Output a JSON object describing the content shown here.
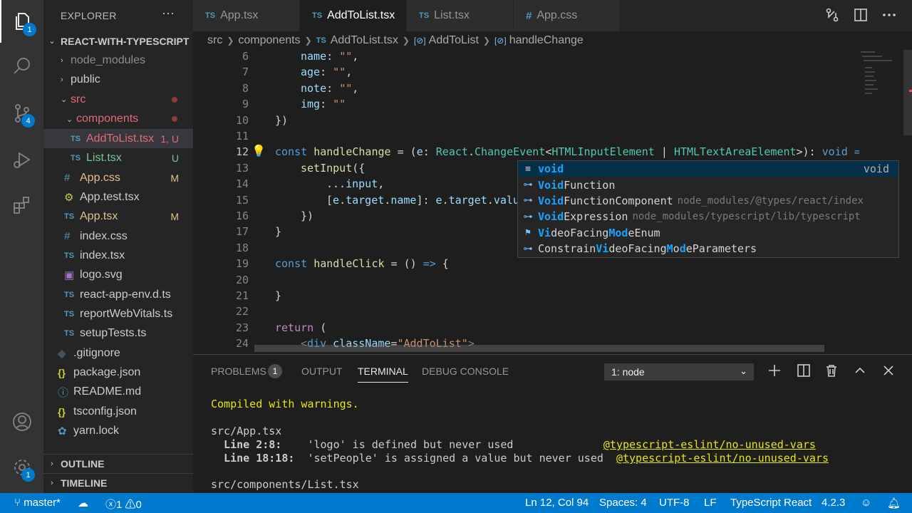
{
  "activity": {
    "explorer_badge": "1",
    "extensions_badge": "4",
    "settings_badge": "1"
  },
  "sidebar": {
    "title": "EXPLORER",
    "more": "···",
    "project": "REACT-WITH-TYPESCRIPT",
    "items": [
      {
        "label": "node_modules",
        "kind": "folder",
        "status": ""
      },
      {
        "label": "public",
        "kind": "folder",
        "status": ""
      },
      {
        "label": "src",
        "kind": "folder-open",
        "status": ""
      },
      {
        "label": "components",
        "kind": "folder-open",
        "status": ""
      },
      {
        "label": "AddToList.tsx",
        "kind": "ts",
        "status": "1, U"
      },
      {
        "label": "List.tsx",
        "kind": "ts",
        "status": "U"
      },
      {
        "label": "App.css",
        "kind": "css",
        "status": "M"
      },
      {
        "label": "App.test.tsx",
        "kind": "test",
        "status": ""
      },
      {
        "label": "App.tsx",
        "kind": "ts",
        "status": "M"
      },
      {
        "label": "index.css",
        "kind": "css",
        "status": ""
      },
      {
        "label": "index.tsx",
        "kind": "ts",
        "status": ""
      },
      {
        "label": "logo.svg",
        "kind": "svg",
        "status": ""
      },
      {
        "label": "react-app-env.d.ts",
        "kind": "ts",
        "status": ""
      },
      {
        "label": "reportWebVitals.ts",
        "kind": "ts",
        "status": ""
      },
      {
        "label": "setupTests.ts",
        "kind": "ts",
        "status": ""
      },
      {
        "label": ".gitignore",
        "kind": "git",
        "status": ""
      },
      {
        "label": "package.json",
        "kind": "json",
        "status": ""
      },
      {
        "label": "README.md",
        "kind": "info",
        "status": ""
      },
      {
        "label": "tsconfig.json",
        "kind": "json",
        "status": ""
      },
      {
        "label": "yarn.lock",
        "kind": "yarn",
        "status": ""
      }
    ],
    "outline": "OUTLINE",
    "timeline": "TIMELINE"
  },
  "tabs": [
    {
      "icon": "TS",
      "label": "App.tsx"
    },
    {
      "icon": "TS",
      "label": "AddToList.tsx"
    },
    {
      "icon": "TS",
      "label": "List.tsx"
    },
    {
      "icon": "#",
      "label": "App.css"
    }
  ],
  "breadcrumb": {
    "src": "src",
    "components": "components",
    "file": "AddToList.tsx",
    "component": "AddToList",
    "fn": "handleChange",
    "ts": "TS",
    "sym": "[⊘]"
  },
  "editor": {
    "line_numbers": [
      "6",
      "7",
      "8",
      "9",
      "10",
      "11",
      "12",
      "13",
      "14",
      "15",
      "16",
      "17",
      "18",
      "19",
      "20",
      "21",
      "22",
      "23",
      "24"
    ],
    "lines": {
      "l6a": "name",
      "l6b": ": ",
      "l6c": "\"\"",
      "l6d": ",",
      "l7a": "age",
      "l7b": ": ",
      "l7c": "\"\"",
      "l7d": ",",
      "l8a": "note",
      "l8b": ": ",
      "l8c": "\"\"",
      "l8d": ",",
      "l9a": "img",
      "l9b": ": ",
      "l9c": "\"\"",
      "l10": "})",
      "l12a": "const ",
      "l12b": "handleChange",
      "l12c": " = (",
      "l12d": "e",
      "l12e": ": ",
      "l12f": "React",
      "l12g": ".",
      "l12h": "ChangeEvent",
      "l12i": "<",
      "l12j": "HTMLInputElement",
      "l12k": " | ",
      "l12l": "HTMLTextAreaElement",
      "l12m": ">): ",
      "l12n": "void",
      "l12o": " =>",
      "l13a": "setInput",
      "l13b": "({",
      "l14a": "...",
      "l14b": "input",
      "l14c": ",",
      "l15a": "[",
      "l15b": "e",
      "l15c": ".",
      "l15d": "target",
      "l15e": ".",
      "l15f": "name",
      "l15g": "]: ",
      "l15h": "e",
      "l15i": ".",
      "l15j": "target",
      "l15k": ".",
      "l15l": "value",
      "l16": "})",
      "l17": "}",
      "l19a": "const ",
      "l19b": "handleClick",
      "l19c": " = () ",
      "l19d": "=>",
      "l19e": " {",
      "l21": "}",
      "l23a": "return",
      "l23b": " (",
      "l24a": "<",
      "l24b": "div",
      "l24c": " ",
      "l24d": "className",
      "l24e": "=",
      "l24f": "\"AddToList\"",
      "l24g": ">"
    }
  },
  "suggest": {
    "items": [
      {
        "icon": "≡",
        "match": "void",
        "rest": "",
        "detail": "",
        "right": "void"
      },
      {
        "icon": "⊶",
        "match": "Void",
        "rest": "Function",
        "detail": "",
        "right": ""
      },
      {
        "icon": "⊶",
        "match": "Void",
        "rest": "FunctionComponent",
        "detail": "node_modules/@types/react/index",
        "right": ""
      },
      {
        "icon": "⊶",
        "match": "Void",
        "rest": "Expression",
        "detail": "node_modules/typescript/lib/typescript",
        "right": ""
      },
      {
        "icon": "⚑",
        "p1": "V",
        "p2": "i",
        "p3": "deoFacing",
        "p4": "Mod",
        "p5": "eEnum"
      },
      {
        "icon": "⊶",
        "p1": "Constrain",
        "p2": "Vi",
        "p3": "deoFacing",
        "p4": "M",
        "p5": "o",
        "p6": "d",
        "p7": "eParameters"
      }
    ]
  },
  "panel": {
    "tabs": [
      "PROBLEMS",
      "OUTPUT",
      "TERMINAL",
      "DEBUG CONSOLE"
    ],
    "problems_count": "1",
    "terminal_select": "1: node",
    "terminal": {
      "compiled": "Compiled with warnings.",
      "file1": "src/App.tsx",
      "w1_loc": "  Line 2:8:",
      "w1_msg": "    'logo' is defined but never used              ",
      "w1_rule": "@typescript-eslint/no-unused-vars",
      "w2_loc": "  Line 18:18:",
      "w2_msg": "  'setPeople' is assigned a value but never used  ",
      "w2_rule": "@typescript-eslint/no-unused-vars",
      "file2": "src/components/List.tsx"
    }
  },
  "status": {
    "branch": "master*",
    "errors": "1",
    "warnings": "0",
    "position": "Ln 12, Col 94",
    "spaces": "Spaces: 4",
    "encoding": "UTF-8",
    "eol": "LF",
    "language": "TypeScript React",
    "version": "4.2.3"
  }
}
